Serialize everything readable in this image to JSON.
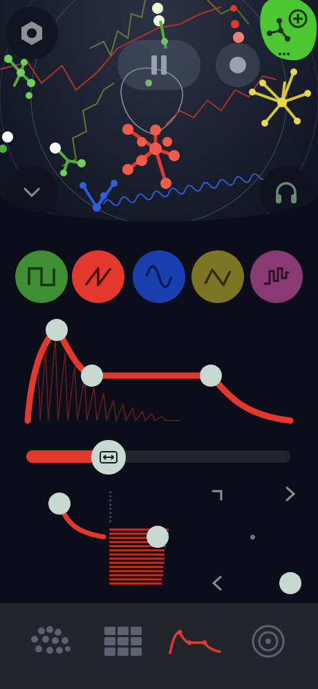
{
  "colors": {
    "background": "#0b0d19",
    "accent_red": "#e2382d",
    "knob": "#c7d9d1",
    "green": "#3f8e34",
    "blue": "#1c3fb0",
    "olive": "#7c7624",
    "magenta": "#8a3a72",
    "add_green": "#4cc733",
    "icon_gray": "#6f7482",
    "tabbar": "#23252c"
  },
  "scene": {
    "controls": {
      "settings": "hexagon-nut-icon",
      "add": "plus-molecule-icon",
      "pause": "pause-icon",
      "record": "record-icon",
      "collapse": "chevron-down-icon",
      "headphones": "headphones-icon"
    }
  },
  "waveforms": [
    {
      "icon": "square-wave-icon",
      "color": "#3f8e34",
      "selected": false
    },
    {
      "icon": "saw-wave-icon",
      "color": "#e2382d",
      "selected": true
    },
    {
      "icon": "sine-wave-icon",
      "color": "#1c3fb0",
      "selected": false
    },
    {
      "icon": "triangle-wave-icon",
      "color": "#7c7624",
      "selected": false
    },
    {
      "icon": "step-wave-icon",
      "color": "#8a3a72",
      "selected": false
    }
  ],
  "envelope": {
    "attack": 0.15,
    "decay": 0.42,
    "sustain": 0.5,
    "release": 0.85
  },
  "slider": {
    "value": 0.27,
    "icon": "left-right-arrows-icon"
  },
  "lower_controls": {
    "arrows": [
      "corner-arrow-icon",
      "chevron-right-icon",
      "chevron-left-icon"
    ]
  },
  "tabs": [
    {
      "icon": "molecule-dots-icon",
      "active": false
    },
    {
      "icon": "grid-icon",
      "active": false
    },
    {
      "icon": "envelope-curve-icon",
      "active": true
    },
    {
      "icon": "target-icon",
      "active": false
    }
  ]
}
